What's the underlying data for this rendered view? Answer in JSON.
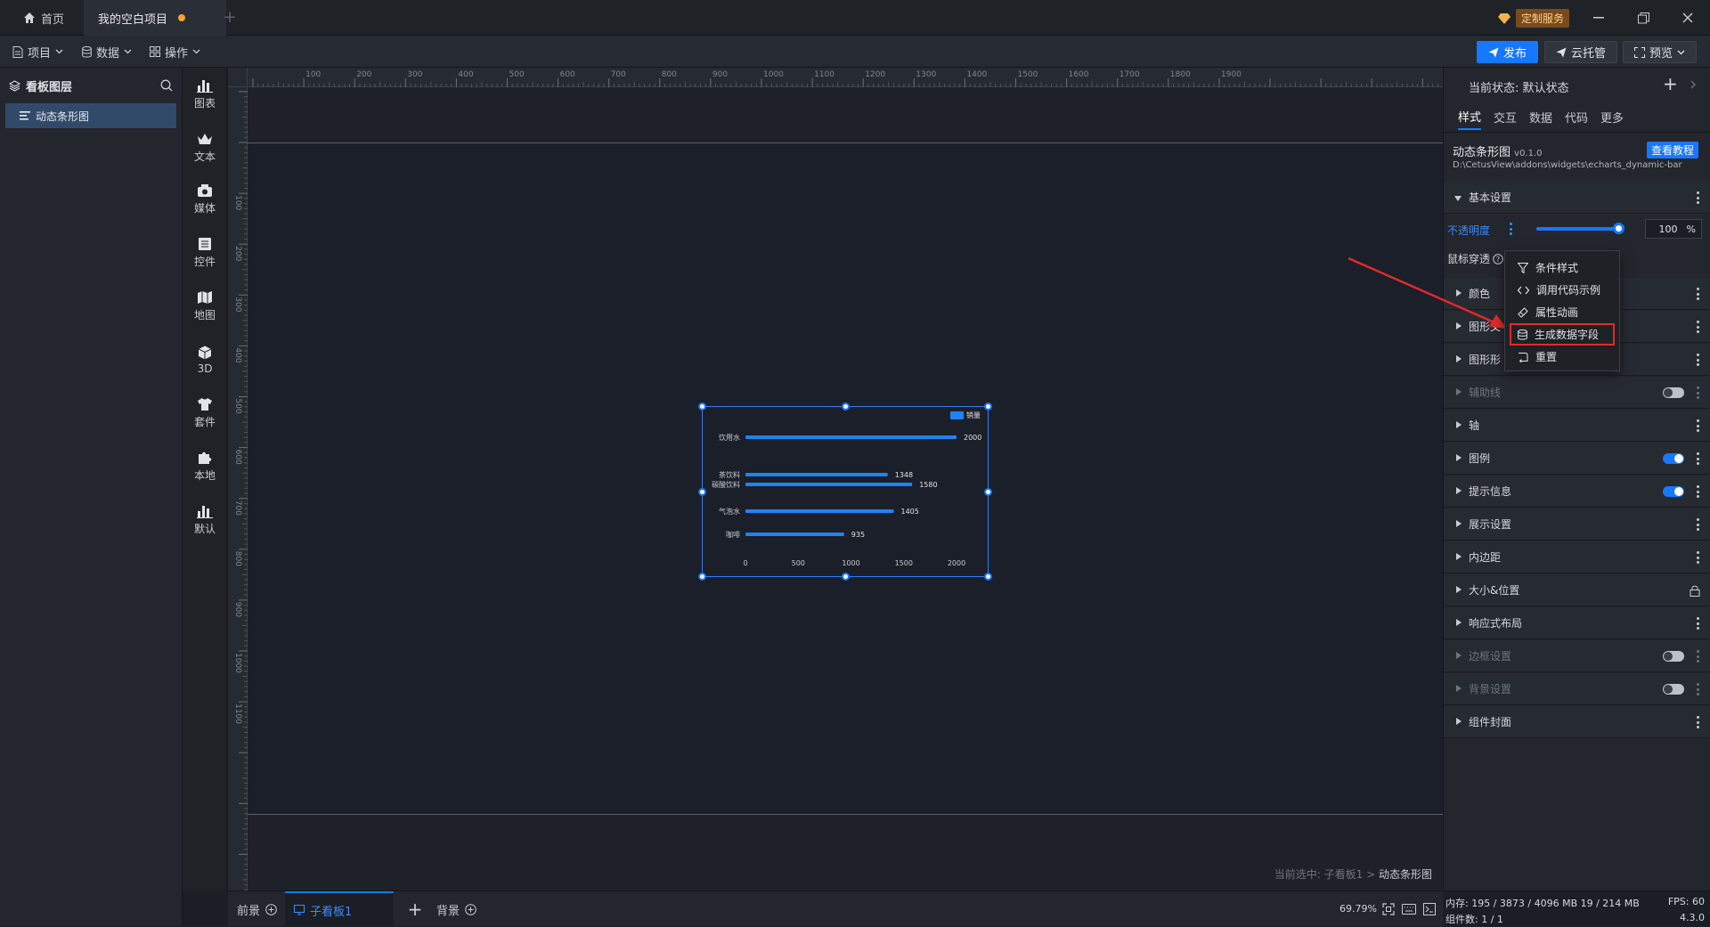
{
  "titlebar": {
    "tabs": [
      {
        "label": "首页"
      },
      {
        "label": "我的空白项目"
      }
    ],
    "custom_service": "定制服务"
  },
  "toolbar": {
    "menus": [
      "项目",
      "数据",
      "操作"
    ],
    "publish": "发布",
    "cloud": "云托管",
    "preview": "预览"
  },
  "layers": {
    "title": "看板图层",
    "items": [
      "动态条形图"
    ]
  },
  "tools": [
    "图表",
    "文本",
    "媒体",
    "控件",
    "地图",
    "3D",
    "套件",
    "本地",
    "默认"
  ],
  "ruler": {
    "top": [
      "100",
      "200",
      "300",
      "400",
      "500",
      "600",
      "700",
      "800",
      "900",
      "1000",
      "1100",
      "1200",
      "1300",
      "1400",
      "1500",
      "1600",
      "1700",
      "1800",
      "1900"
    ],
    "left": [
      "100",
      "200",
      "300",
      "400",
      "500",
      "600",
      "700",
      "800",
      "900",
      "1000",
      "1100"
    ]
  },
  "chart_data": {
    "type": "bar",
    "orientation": "horizontal",
    "categories": [
      "饮用水",
      "茶饮料",
      "碳酸饮料",
      "气泡水",
      "咖啡"
    ],
    "series": [
      {
        "name": "销量",
        "values": [
          2000,
          1348,
          1580,
          1405,
          935
        ],
        "color": "#1e84f5"
      }
    ],
    "xticks": [
      "0",
      "500",
      "1000",
      "1500",
      "2000"
    ],
    "xlim": [
      0,
      2000
    ],
    "legend_position": "top-right"
  },
  "canvas": {
    "breadcrumb_prefix": "当前选中: 子看板1 >",
    "breadcrumb_current": "动态条形图"
  },
  "bottombar": {
    "tabs": [
      "前景",
      "子看板1",
      "背景"
    ],
    "zoom": "69.79%"
  },
  "props": {
    "state_label": "当前状态:",
    "state_value": "默认状态",
    "tabs": [
      "样式",
      "交互",
      "数据",
      "代码",
      "更多"
    ],
    "widget_name": "动态条形图",
    "widget_version": "v0.1.0",
    "tutorial": "查看教程",
    "widget_path": "D:\\CetusView\\addons\\widgets\\echarts_dynamic-bar",
    "basic_settings": "基本设置",
    "opacity_label": "不透明度",
    "opacity_value": "100",
    "opacity_unit": "%",
    "opacity_level": 100,
    "mouse_through": "鼠标穿透",
    "sections": [
      {
        "label": "颜色",
        "dim": false,
        "toggle": null
      },
      {
        "label": "图形文",
        "dim": false,
        "toggle": null
      },
      {
        "label": "图形形",
        "dim": false,
        "toggle": null
      },
      {
        "label": "辅助线",
        "dim": true,
        "toggle": "off"
      },
      {
        "label": "轴",
        "dim": false,
        "toggle": null
      },
      {
        "label": "图例",
        "dim": false,
        "toggle": "on"
      },
      {
        "label": "提示信息",
        "dim": false,
        "toggle": "on"
      },
      {
        "label": "展示设置",
        "dim": false,
        "toggle": null
      },
      {
        "label": "内边距",
        "dim": false,
        "toggle": null
      },
      {
        "label": "大小&位置",
        "dim": false,
        "toggle": "lock"
      },
      {
        "label": "响应式布局",
        "dim": false,
        "toggle": null
      },
      {
        "label": "边框设置",
        "dim": true,
        "toggle": "off"
      },
      {
        "label": "背景设置",
        "dim": true,
        "toggle": "off"
      },
      {
        "label": "组件封面",
        "dim": false,
        "toggle": null
      }
    ]
  },
  "context_menu": {
    "items": [
      "条件样式",
      "调用代码示例",
      "属性动画",
      "生成数据字段",
      "重置"
    ]
  },
  "statusbar": {
    "memory": "内存: 195 / 3873 / 4096 MB 19 / 214 MB",
    "fps": "FPS: 60",
    "components": "组件数: 1 / 1",
    "version": "4.3.0"
  }
}
